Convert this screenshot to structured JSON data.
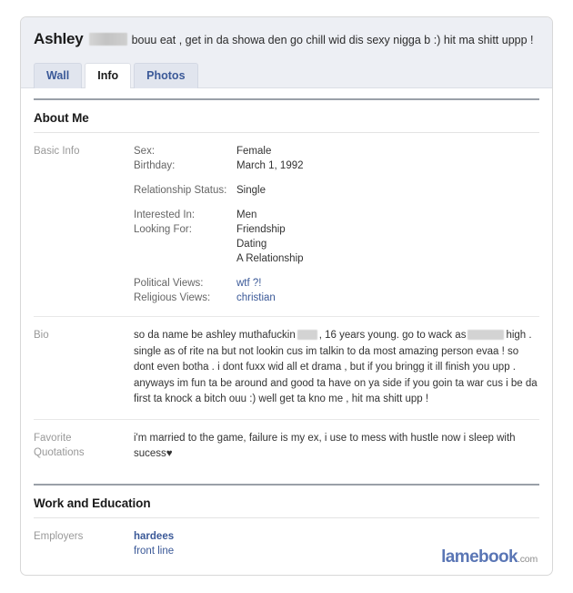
{
  "header": {
    "profile_name": "Ashley",
    "name_redacted": true,
    "status_text": "bouu eat , get in da showa den go chill wid dis sexy nigga b :) hit ma shitt uppp !",
    "background_color": "#edeff4"
  },
  "tabs": [
    {
      "label": "Wall",
      "active": false
    },
    {
      "label": "Info",
      "active": true
    },
    {
      "label": "Photos",
      "active": false
    }
  ],
  "sections": {
    "about_me": {
      "title": "About Me",
      "basic_info": {
        "label": "Basic Info",
        "group_1": [
          {
            "key": "Sex:",
            "value": "Female"
          },
          {
            "key": "Birthday:",
            "value": "March 1, 1992"
          }
        ],
        "group_2": [
          {
            "key": "Relationship Status:",
            "value": "Single"
          }
        ],
        "group_3": [
          {
            "key": "Interested In:",
            "value": "Men"
          },
          {
            "key": "Looking For:",
            "value": "Friendship"
          }
        ],
        "looking_for_extra": [
          "Dating",
          "A Relationship"
        ],
        "group_4": [
          {
            "key": "Political Views:",
            "value": "wtf ?!",
            "is_link": true
          },
          {
            "key": "Religious Views:",
            "value": "christian",
            "is_link": true
          }
        ]
      },
      "bio": {
        "label": "Bio",
        "part_1": "so da name be ashley muthafuckin",
        "part_2": ", 16 years young. go to wack as",
        "part_3": "high . single as of rite na but not lookin cus im talkin to da most amazing person evaa ! so dont even botha . i dont fuxx wid all et drama , but if you bringg it ill finish you upp . anyways im fun ta be around and good ta have on ya side if you goin ta war cus i be da first ta knock a bitch ouu :) well get ta kno me , hit ma shitt upp !"
      },
      "favorite_quotations": {
        "label_line_1": "Favorite",
        "label_line_2": "Quotations",
        "text": "i'm married to the game, failure is my ex, i use to mess with hustle now i sleep with sucess♥"
      }
    },
    "work_and_education": {
      "title": "Work and Education",
      "employers": {
        "label": "Employers",
        "primary": "hardees",
        "secondary": "front line"
      }
    }
  },
  "watermark": {
    "name": "lamebook",
    "tld": ".com",
    "color": "#5a76b5"
  }
}
